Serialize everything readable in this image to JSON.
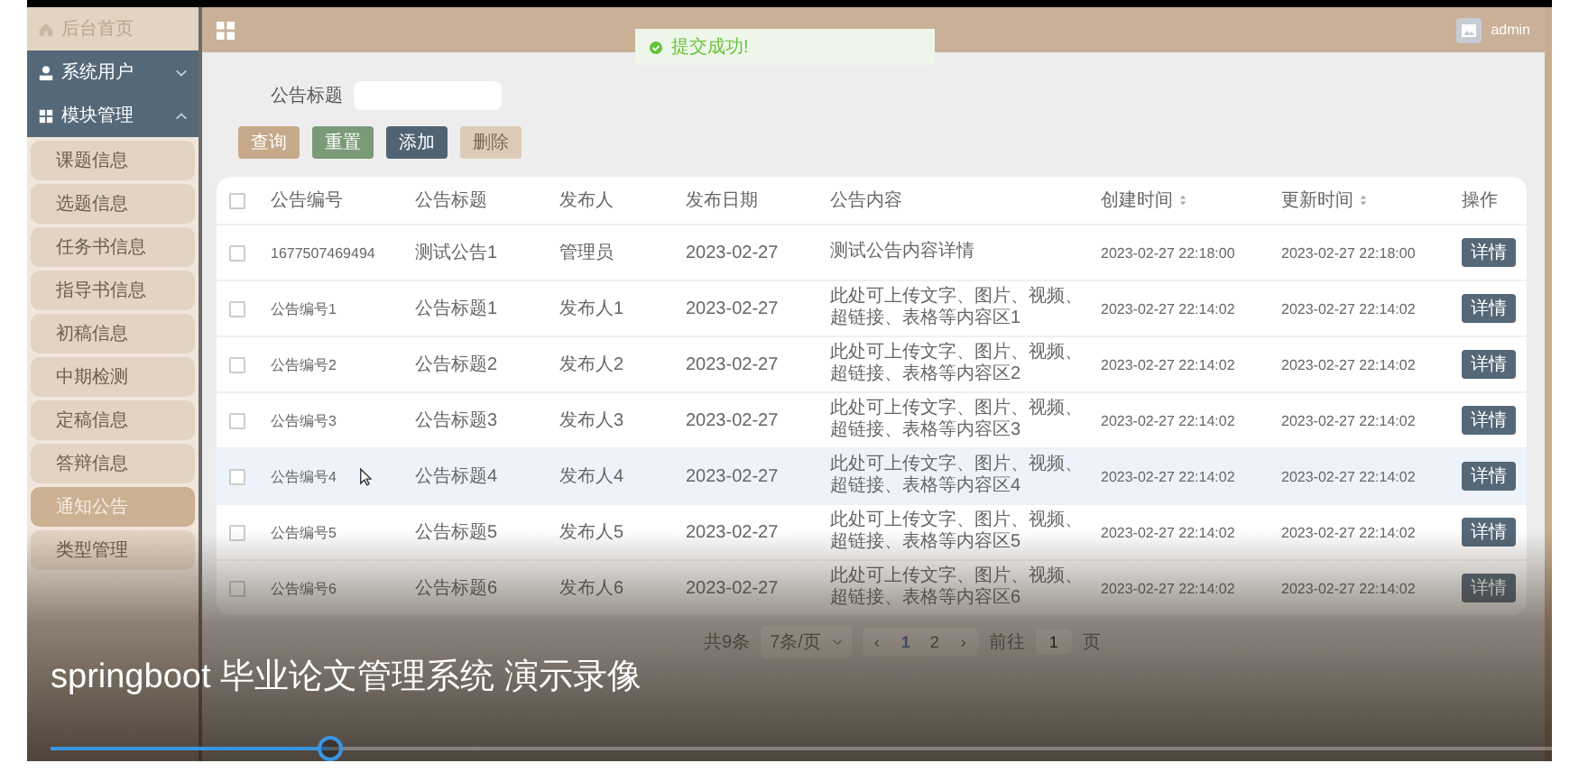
{
  "sidebar": {
    "home": "后台首页",
    "groups": [
      {
        "label": "系统用户",
        "expanded": false
      },
      {
        "label": "模块管理",
        "expanded": true,
        "children": [
          {
            "label": "课题信息",
            "selected": false
          },
          {
            "label": "选题信息",
            "selected": false
          },
          {
            "label": "任务书信息",
            "selected": false
          },
          {
            "label": "指导书信息",
            "selected": false
          },
          {
            "label": "初稿信息",
            "selected": false
          },
          {
            "label": "中期检测",
            "selected": false
          },
          {
            "label": "定稿信息",
            "selected": false
          },
          {
            "label": "答辩信息",
            "selected": false
          },
          {
            "label": "通知公告",
            "selected": true
          },
          {
            "label": "类型管理",
            "selected": false
          }
        ]
      }
    ]
  },
  "header": {
    "user": "admin"
  },
  "toast": {
    "message": "提交成功!"
  },
  "search": {
    "label": "公告标题"
  },
  "buttons": [
    {
      "label": "查询",
      "kind": "search",
      "disabled": false
    },
    {
      "label": "重置",
      "kind": "reset",
      "disabled": false
    },
    {
      "label": "添加",
      "kind": "add",
      "disabled": false
    },
    {
      "label": "删除",
      "kind": "delete",
      "disabled": true
    }
  ],
  "table": {
    "all_checked": false,
    "columns": [
      {
        "label": "公告编号",
        "sortable": false
      },
      {
        "label": "公告标题",
        "sortable": false
      },
      {
        "label": "发布人",
        "sortable": false
      },
      {
        "label": "发布日期",
        "sortable": false
      },
      {
        "label": "公告内容",
        "sortable": false
      },
      {
        "label": "创建时间",
        "sortable": true
      },
      {
        "label": "更新时间",
        "sortable": true
      },
      {
        "label": "操作",
        "sortable": false
      }
    ],
    "rows": [
      {
        "checked": false,
        "highlighted": false,
        "cells": [
          "1677507469494",
          "测试公告1",
          "管理员",
          "2023-02-27",
          "测试公告内容详情",
          "2023-02-27 22:18:00",
          "2023-02-27 22:18:00"
        ],
        "action": "详情"
      },
      {
        "checked": false,
        "highlighted": false,
        "cells": [
          "公告编号1",
          "公告标题1",
          "发布人1",
          "2023-02-27",
          "此处可上传文字、图片、视频、超链接、表格等内容区1",
          "2023-02-27 22:14:02",
          "2023-02-27 22:14:02"
        ],
        "action": "详情"
      },
      {
        "checked": false,
        "highlighted": false,
        "cells": [
          "公告编号2",
          "公告标题2",
          "发布人2",
          "2023-02-27",
          "此处可上传文字、图片、视频、超链接、表格等内容区2",
          "2023-02-27 22:14:02",
          "2023-02-27 22:14:02"
        ],
        "action": "详情"
      },
      {
        "checked": false,
        "highlighted": false,
        "cells": [
          "公告编号3",
          "公告标题3",
          "发布人3",
          "2023-02-27",
          "此处可上传文字、图片、视频、超链接、表格等内容区3",
          "2023-02-27 22:14:02",
          "2023-02-27 22:14:02"
        ],
        "action": "详情"
      },
      {
        "checked": false,
        "highlighted": true,
        "cells": [
          "公告编号4",
          "公告标题4",
          "发布人4",
          "2023-02-27",
          "此处可上传文字、图片、视频、超链接、表格等内容区4",
          "2023-02-27 22:14:02",
          "2023-02-27 22:14:02"
        ],
        "action": "详情"
      },
      {
        "checked": false,
        "highlighted": false,
        "cells": [
          "公告编号5",
          "公告标题5",
          "发布人5",
          "2023-02-27",
          "此处可上传文字、图片、视频、超链接、表格等内容区5",
          "2023-02-27 22:14:02",
          "2023-02-27 22:14:02"
        ],
        "action": "详情"
      },
      {
        "checked": false,
        "highlighted": false,
        "cells": [
          "公告编号6",
          "公告标题6",
          "发布人6",
          "2023-02-27",
          "此处可上传文字、图片、视频、超链接、表格等内容区6",
          "2023-02-27 22:14:02",
          "2023-02-27 22:14:02"
        ],
        "action": "详情"
      }
    ]
  },
  "pagination": {
    "total": "共9条",
    "page_size": "7条/页",
    "prev": "‹",
    "pages": [
      {
        "label": "1",
        "selected": true
      },
      {
        "label": "2",
        "selected": false
      }
    ],
    "next": "›",
    "goto": "前往",
    "goto_value": "1",
    "page_suffix": "页"
  },
  "player": {
    "caption": "springboot 毕业论文管理系统 演示录像",
    "progress": {
      "level": 0.185
    }
  }
}
